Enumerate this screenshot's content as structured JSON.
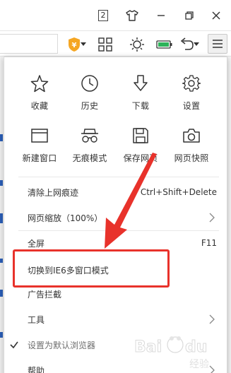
{
  "titlebar": {
    "tab_count": "2",
    "icons": [
      "tab-count-icon",
      "skin-shirt-icon",
      "minimize-icon",
      "restore-icon",
      "close-icon"
    ]
  },
  "toolbar": {
    "icons": [
      "shield-icon",
      "dropdown-caret-icon",
      "apps-grid-icon",
      "brightness-icon",
      "battery-icon",
      "undo-icon",
      "menu-icon"
    ],
    "accent_color": "#f5a623",
    "battery_color": "#2db35a"
  },
  "menu": {
    "grid": [
      {
        "label": "收藏",
        "icon": "star-icon"
      },
      {
        "label": "历史",
        "icon": "clock-icon"
      },
      {
        "label": "下载",
        "icon": "download-icon"
      },
      {
        "label": "设置",
        "icon": "gear-icon"
      },
      {
        "label": "新建窗口",
        "icon": "new-window-icon"
      },
      {
        "label": "无痕模式",
        "icon": "incognito-icon"
      },
      {
        "label": "保存网页",
        "icon": "save-icon"
      },
      {
        "label": "网页快照",
        "icon": "camera-icon"
      }
    ],
    "items": [
      {
        "label": "清除上网痕迹",
        "shortcut": "Ctrl+Shift+Delete"
      },
      {
        "label": "网页缩放（100%）",
        "shortcut": ""
      },
      {
        "label": "全屏",
        "shortcut": "F11"
      },
      {
        "label": "切换到IE6多窗口模式",
        "shortcut": ""
      },
      {
        "label": "广告拦截",
        "shortcut": ""
      },
      {
        "label": "工具",
        "shortcut": ""
      },
      {
        "label": "设置为默认浏览器",
        "shortcut": ""
      },
      {
        "label": "帮助",
        "shortcut": ""
      }
    ]
  },
  "annotation": {
    "highlight_color": "#e8322b"
  },
  "watermark": {
    "text": "Baidu 经验"
  }
}
